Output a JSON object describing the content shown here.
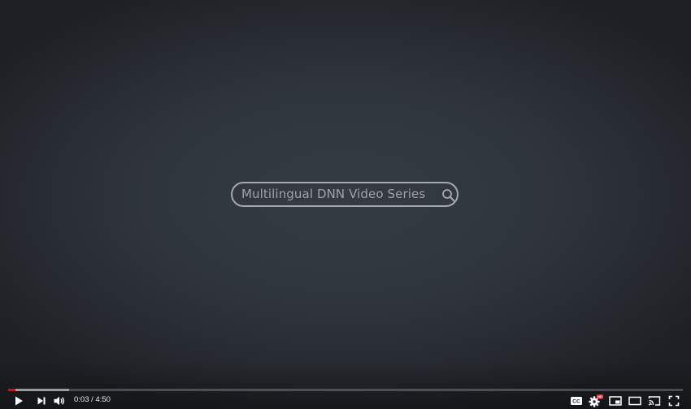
{
  "video": {
    "overlay_search_text": "Multilingual DNN Video Series"
  },
  "progress": {
    "played_fraction": 0.0105,
    "buffered_fraction": 0.09
  },
  "time": {
    "current": "0:03",
    "separator": " / ",
    "duration": "4:50"
  },
  "icons": {
    "play": "play-icon",
    "next": "next-icon",
    "volume": "volume-icon",
    "captions": "cc-icon",
    "settings": "settings-gear-icon",
    "settings_badge": "HD",
    "miniplayer": "miniplayer-icon",
    "theater": "theater-mode-icon",
    "cast": "cast-icon",
    "fullscreen": "fullscreen-icon"
  },
  "colors": {
    "played": "#ff0000",
    "hd_badge": "#e02020",
    "icon": "#ffffff",
    "search_outline": "#a5a9ae"
  }
}
